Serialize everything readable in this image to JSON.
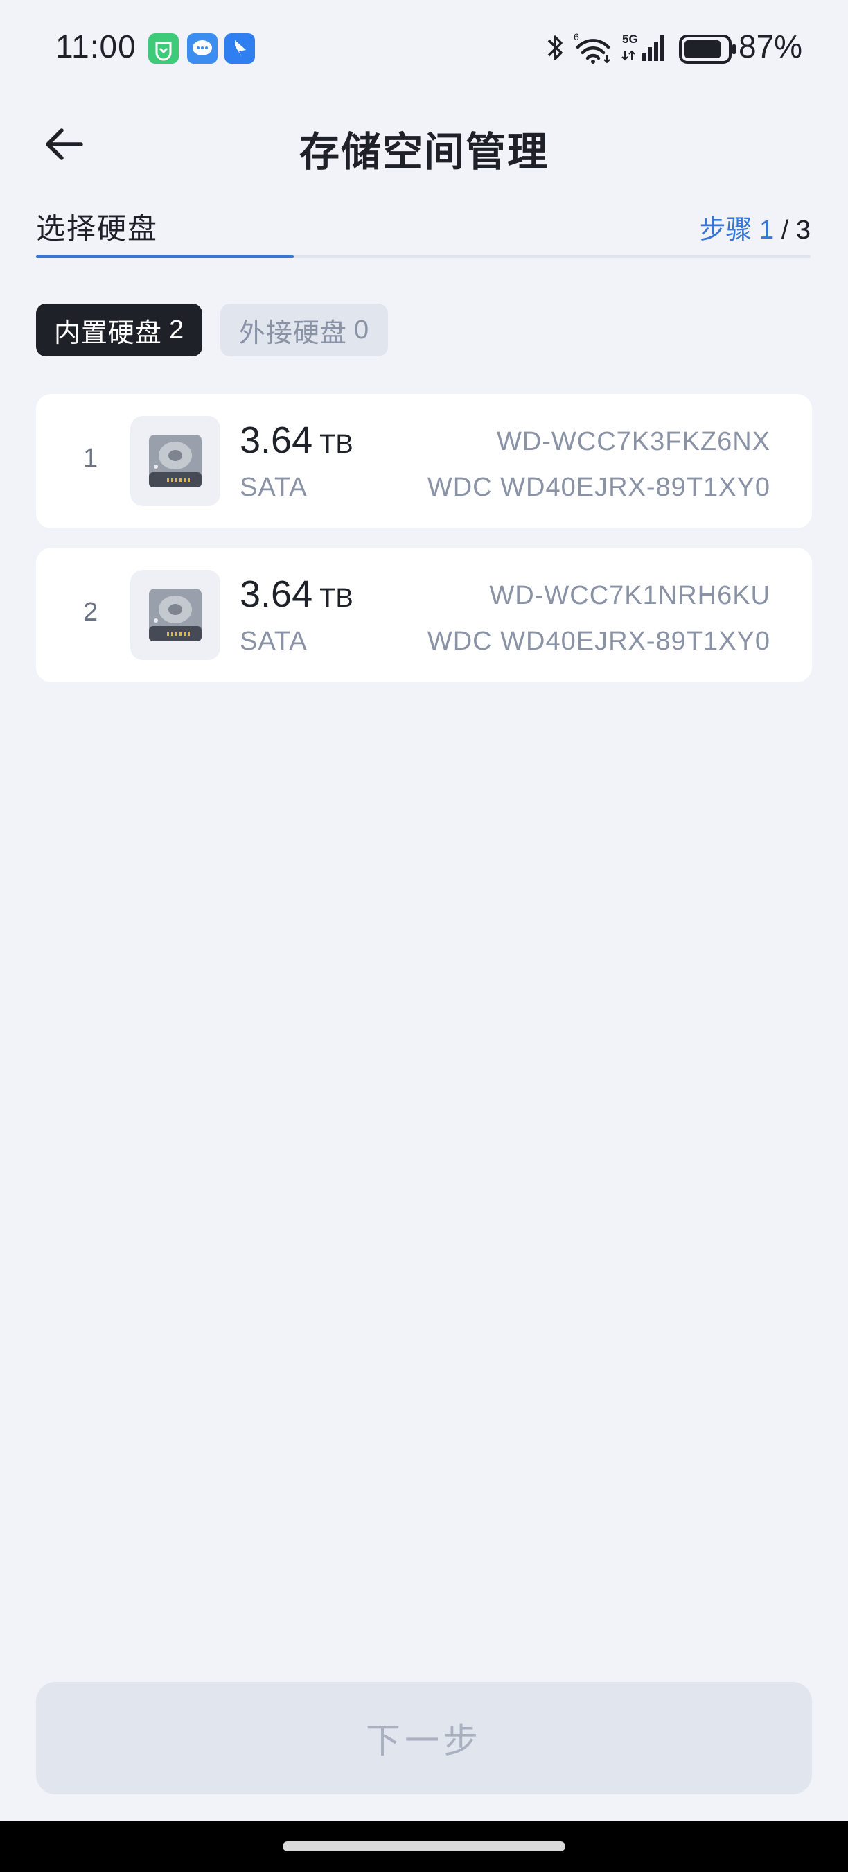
{
  "status_bar": {
    "time": "11:00",
    "battery_percent": "87%",
    "battery_level": 0.87,
    "notification_icons": [
      "mi-home-icon",
      "messages-icon",
      "feishu-icon"
    ],
    "system_icons": [
      "bluetooth-icon",
      "wifi-6-icon",
      "5g-signal-icon",
      "battery-icon"
    ]
  },
  "header": {
    "title": "存储空间管理",
    "back_icon": "arrow-left-icon"
  },
  "step": {
    "label": "选择硬盘",
    "prefix": "步骤",
    "current": "1",
    "separator": "/",
    "total": "3",
    "progress": 0.333
  },
  "filters": [
    {
      "label": "内置硬盘",
      "count": "2",
      "selected": true
    },
    {
      "label": "外接硬盘",
      "count": "0",
      "selected": false
    }
  ],
  "disks": [
    {
      "index": "1",
      "size": "3.64",
      "unit": "TB",
      "interface": "SATA",
      "serial": "WD-WCC7K3FKZ6NX",
      "model": "WDC WD40EJRX-89T1XY0",
      "icon": "hard-drive-icon"
    },
    {
      "index": "2",
      "size": "3.64",
      "unit": "TB",
      "interface": "SATA",
      "serial": "WD-WCC7K1NRH6KU",
      "model": "WDC WD40EJRX-89T1XY0",
      "icon": "hard-drive-icon"
    }
  ],
  "next_button": {
    "label": "下一步",
    "enabled": false
  },
  "colors": {
    "background": "#f1f3f9",
    "accent": "#3576d6",
    "chip_active": "#1e2128",
    "text_secondary": "#8a93a6",
    "button_disabled": "#e1e5ee"
  }
}
